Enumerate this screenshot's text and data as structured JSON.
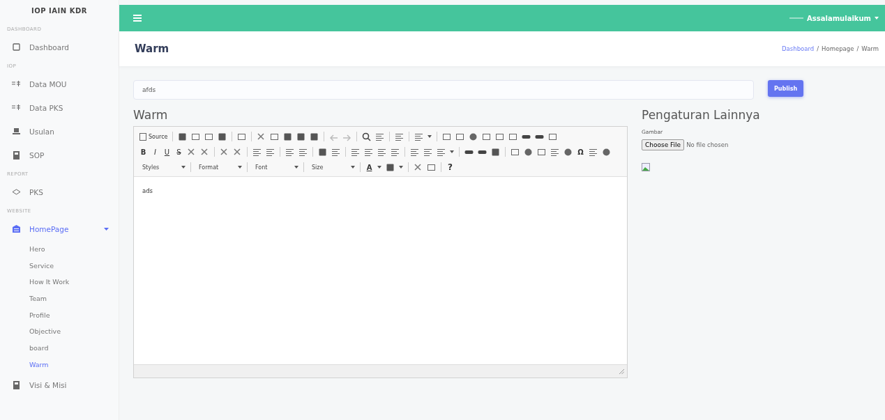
{
  "brand": "IOP IAIN KDR",
  "sidebar": [
    {
      "heading": "DASHBOARD",
      "items": [
        {
          "label": "Dashboard",
          "selected": false
        }
      ]
    },
    {
      "heading": "IOP",
      "items": [
        {
          "label": "Data MOU",
          "selected": false
        },
        {
          "label": "Data PKS",
          "selected": false
        },
        {
          "label": "Usulan",
          "selected": false
        },
        {
          "label": "SOP",
          "selected": false
        }
      ]
    },
    {
      "heading": "REPORT",
      "items": [
        {
          "label": "PKS",
          "selected": false
        }
      ]
    },
    {
      "heading": "WEBSITE",
      "items": [
        {
          "label": "HomePage",
          "selected": true,
          "expanded": true,
          "children": [
            {
              "label": "Hero",
              "selected": false
            },
            {
              "label": "Service",
              "selected": false
            },
            {
              "label": "How It Work",
              "selected": false
            },
            {
              "label": "Team",
              "selected": false
            },
            {
              "label": "Profile",
              "selected": false
            },
            {
              "label": "Objective",
              "selected": false
            },
            {
              "label": "board",
              "selected": false
            },
            {
              "label": "Warm",
              "selected": true
            }
          ]
        },
        {
          "label": "Visi & Misi",
          "selected": false
        }
      ]
    }
  ],
  "topbar": {
    "user": "Assalamulaikum"
  },
  "page_title": "Warm",
  "breadcrumb": [
    {
      "label": "Dashboard",
      "link": true
    },
    {
      "separator": "/"
    },
    {
      "label": "Homepage",
      "link": false
    },
    {
      "separator": "/"
    },
    {
      "label": "Warm",
      "link": false
    }
  ],
  "title_field": {
    "value": "afds"
  },
  "publish": "Publish",
  "editor": {
    "heading": "Warm",
    "source": "Source",
    "format_buttons": [
      "B",
      "I",
      "U",
      "S"
    ],
    "special_char": "Ω",
    "combos": [
      "Styles",
      "Format",
      "Font",
      "Size"
    ],
    "text_color": "A",
    "help": "?",
    "content": "ads"
  },
  "settings": {
    "heading": "Pengaturan Lainnya",
    "image_label": "Gambar",
    "file_button": "Choose File",
    "file_status": "No file chosen"
  }
}
